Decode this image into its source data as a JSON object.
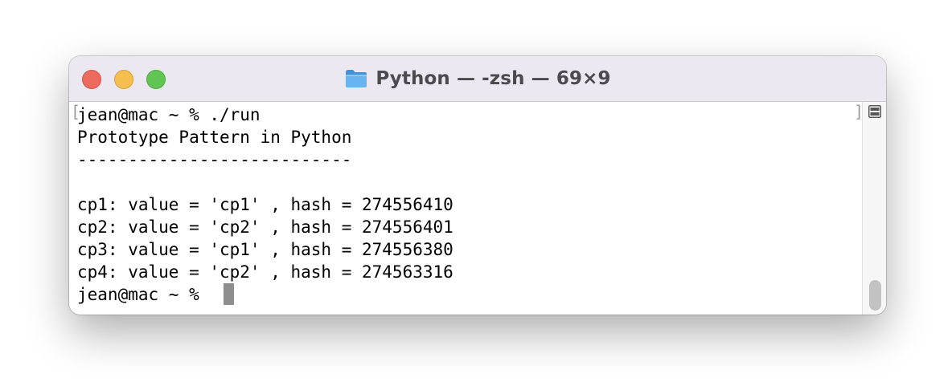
{
  "window": {
    "title": "Python — -zsh — 69×9",
    "controls": {
      "close": {
        "icon": "close-traffic-light",
        "color": "#ec6a5e"
      },
      "minimize": {
        "icon": "minimize-traffic-light",
        "color": "#f4bf4f"
      },
      "zoom": {
        "icon": "zoom-traffic-light",
        "color": "#61c554"
      }
    },
    "title_icon": "folder-icon"
  },
  "terminal": {
    "lines": [
      "jean@mac ~ % ./run",
      "Prototype Pattern in Python",
      "---------------------------",
      "",
      "cp1: value = 'cp1' , hash = 274556410",
      "cp2: value = 'cp2' , hash = 274556401",
      "cp3: value = 'cp1' , hash = 274556380",
      "cp4: value = 'cp2' , hash = 274563316"
    ],
    "prompt": "jean@mac ~ % ",
    "left_mark": "[",
    "right_mark": "]"
  },
  "scrollbar": {
    "split_icon": "split-view-icon"
  }
}
